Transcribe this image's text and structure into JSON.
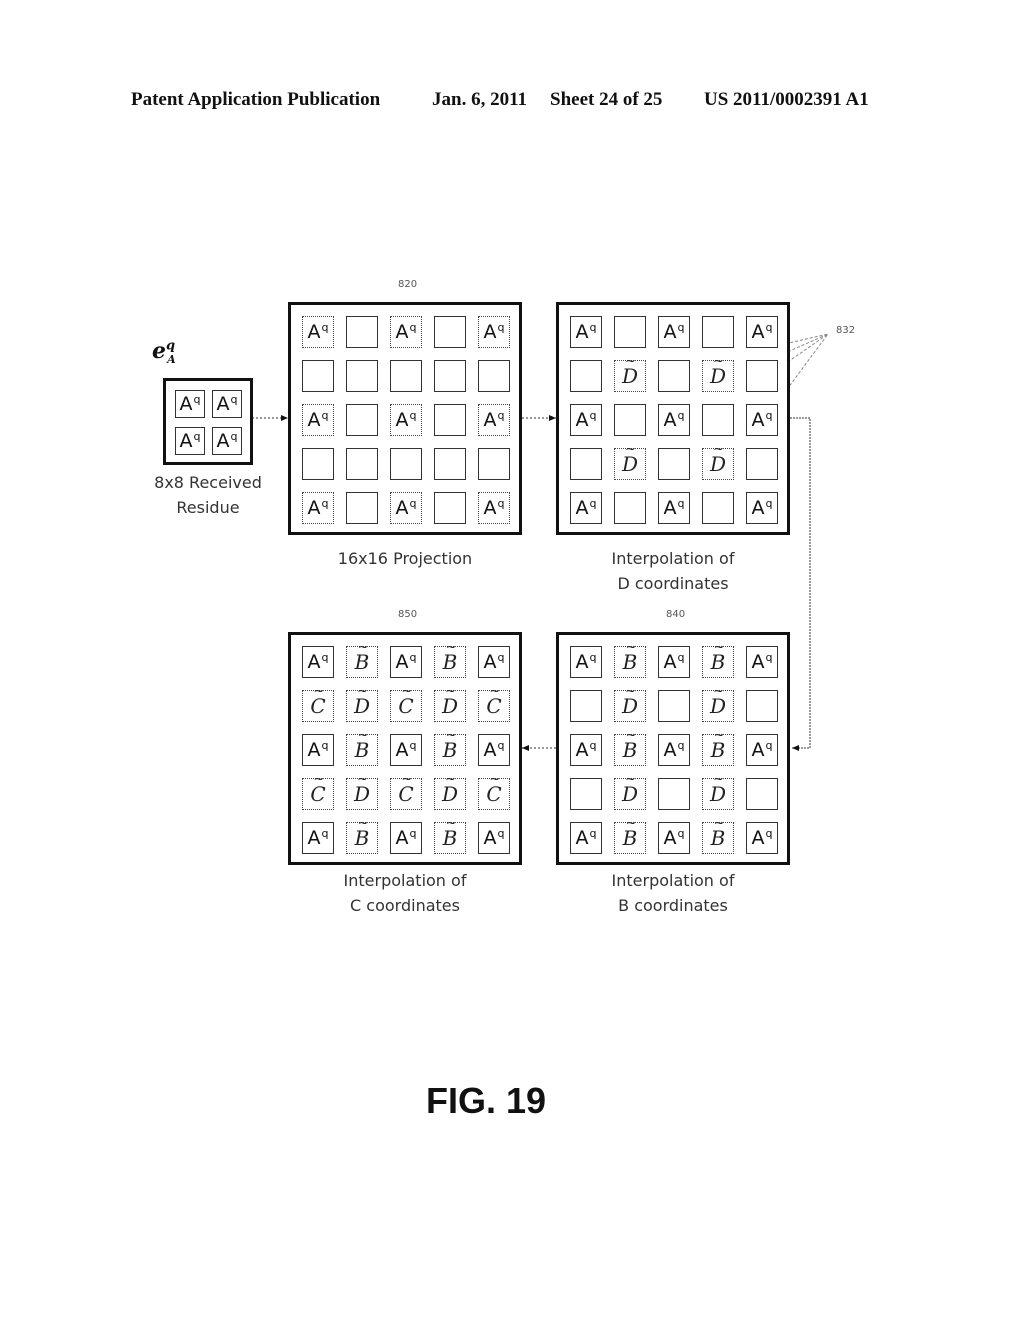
{
  "header": {
    "left": "Patent Application Publication",
    "date": "Jan. 6, 2011",
    "sheet": "Sheet 24 of 25",
    "number": "US 2011/0002391 A1"
  },
  "residue": {
    "symbol_base": "e",
    "symbol_sup": "q",
    "symbol_sub": "A",
    "cells": [
      "A",
      "A",
      "A",
      "A"
    ],
    "cell_sup": "q",
    "label_line1": "8x8 Received",
    "label_line2": "Residue"
  },
  "cell_legend": {
    "A": "Aq (received sample)",
    "B": "interpolated B",
    "C": "interpolated C",
    "D": "interpolated D",
    "": "empty"
  },
  "panels": {
    "projection": {
      "ref": "820",
      "label_line1": "16x16 Projection",
      "label_line2": "",
      "rows": [
        [
          "A",
          "",
          "A",
          "",
          "A"
        ],
        [
          "",
          "",
          "",
          "",
          ""
        ],
        [
          "A",
          "",
          "A",
          "",
          "A"
        ],
        [
          "",
          "",
          "",
          "",
          ""
        ],
        [
          "A",
          "",
          "A",
          "",
          "A"
        ]
      ]
    },
    "interp_d": {
      "ref": "832",
      "label_line1": "Interpolation of",
      "label_line2": "D coordinates",
      "rows": [
        [
          "A",
          "",
          "A",
          "",
          "A"
        ],
        [
          "",
          "D",
          "",
          "D",
          ""
        ],
        [
          "A",
          "",
          "A",
          "",
          "A"
        ],
        [
          "",
          "D",
          "",
          "D",
          ""
        ],
        [
          "A",
          "",
          "A",
          "",
          "A"
        ]
      ]
    },
    "interp_b": {
      "ref": "840",
      "label_line1": "Interpolation of",
      "label_line2": "B coordinates",
      "rows": [
        [
          "A",
          "B",
          "A",
          "B",
          "A"
        ],
        [
          "",
          "D",
          "",
          "D",
          ""
        ],
        [
          "A",
          "B",
          "A",
          "B",
          "A"
        ],
        [
          "",
          "D",
          "",
          "D",
          ""
        ],
        [
          "A",
          "B",
          "A",
          "B",
          "A"
        ]
      ]
    },
    "interp_c": {
      "ref": "850",
      "label_line1": "Interpolation of",
      "label_line2": "C coordinates",
      "rows": [
        [
          "A",
          "B",
          "A",
          "B",
          "A"
        ],
        [
          "C",
          "D",
          "C",
          "D",
          "C"
        ],
        [
          "A",
          "B",
          "A",
          "B",
          "A"
        ],
        [
          "C",
          "D",
          "C",
          "D",
          "C"
        ],
        [
          "A",
          "B",
          "A",
          "B",
          "A"
        ]
      ]
    }
  },
  "figure_label": "FIG. 19"
}
